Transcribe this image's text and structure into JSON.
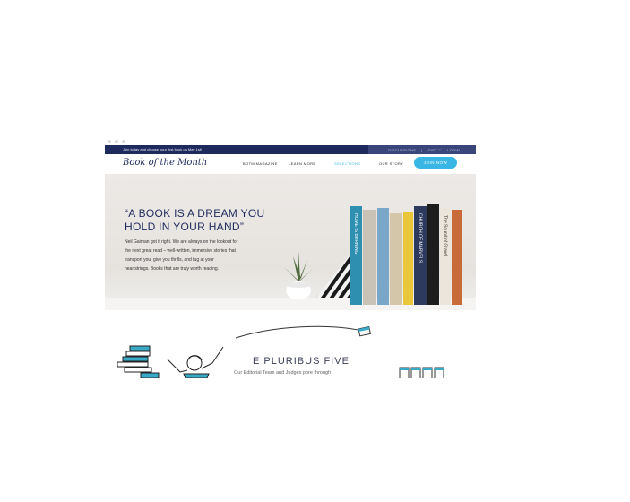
{
  "window": {
    "dots": [
      "dot-1",
      "dot-2",
      "dot-3"
    ]
  },
  "topbar": {
    "promo": "Join today and choose your first book on May 1st!",
    "links": [
      "DISCUSSIONS",
      "|",
      "GIFT ♡",
      "LOGIN"
    ],
    "colors": {
      "bar": "#1e2a5c",
      "right": "#3a4679"
    }
  },
  "nav": {
    "logo": "Book of the Month",
    "links": [
      "BOTM MAGAZINE",
      "LEARN MORE",
      "SELECTIONS",
      "OUR STORY"
    ],
    "active": "SELECTIONS",
    "cta": "JOIN NOW",
    "colors": {
      "accent": "#39b6e4",
      "brand": "#1e2a5c"
    }
  },
  "hero": {
    "quote_lines": [
      "“A BOOK IS A DREAM YOU",
      "HOLD IN YOUR HAND”"
    ],
    "desc_lines": [
      "Neil Gaiman got it right. We are always on the lookout for",
      "the next great read – well-written, immersive stories that",
      "transport you, give you thrills, and tug at your",
      "heartstrings. Books that are truly worth reading."
    ],
    "books": [
      {
        "title": "HOME IS BURNING",
        "color": "#2f8fb0"
      },
      {
        "title": "",
        "color": "#c9c2b6"
      },
      {
        "title": "",
        "color": "#7aa7c7"
      },
      {
        "title": "",
        "color": "#d4c6a8"
      },
      {
        "title": "",
        "color": "#e9c63a"
      },
      {
        "title": "CHURCH OF MARVELS",
        "color": "#2d3a5e"
      },
      {
        "title": "",
        "color": "#1d1d1d"
      },
      {
        "title": "The Sound of Gravel",
        "color": "#ece5dc"
      },
      {
        "title": "",
        "color": "#c96a3a"
      }
    ]
  },
  "section": {
    "title": "E PLURIBUS FIVE",
    "subtitle": "Our Editorial Team and Judges pore through"
  }
}
